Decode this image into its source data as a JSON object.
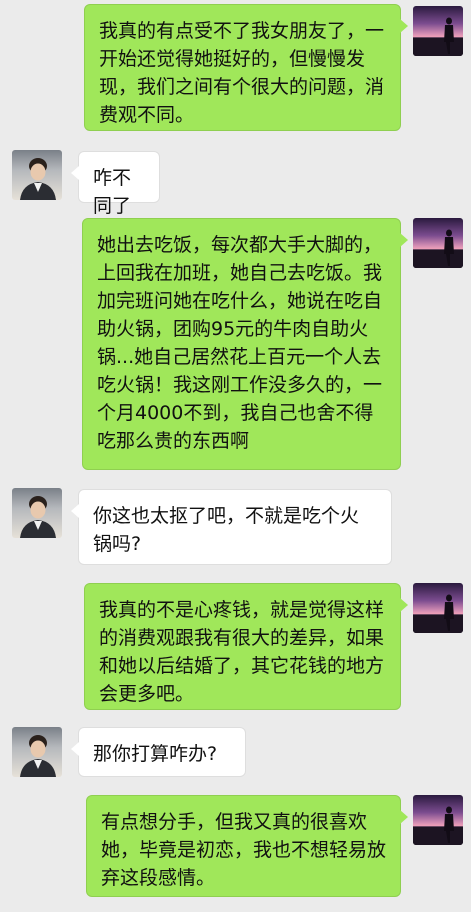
{
  "messages": [
    {
      "sender": "me",
      "text": "我真的有点受不了我女朋友了，一开始还觉得她挺好的，但慢慢发现，我们之间有个很大的问题，消费观不同。"
    },
    {
      "sender": "friend",
      "text": "咋不同了"
    },
    {
      "sender": "me",
      "text": "她出去吃饭，每次都大手大脚的，上回我在加班，她自己去吃饭。我加完班问她在吃什么，她说在吃自助火锅，团购95元的牛肉自助火锅...她自己居然花上百元一个人去吃火锅！我这刚工作没多久的，一个月4000不到，我自己也舍不得吃那么贵的东西啊"
    },
    {
      "sender": "friend",
      "text": "你这也太抠了吧，不就是吃个火锅吗?"
    },
    {
      "sender": "me",
      "text": "我真的不是心疼钱，就是觉得这样的消费观跟我有很大的差异，如果和她以后结婚了，其它花钱的地方会更多吧。"
    },
    {
      "sender": "friend",
      "text": "那你打算咋办?"
    },
    {
      "sender": "me",
      "text": "有点想分手，但我又真的很喜欢她，毕竟是初恋，我也不想轻易放弃这段感情。"
    }
  ],
  "colors": {
    "background": "#ebebeb",
    "my_bubble": "#a0e75a",
    "friend_bubble": "#ffffff"
  }
}
